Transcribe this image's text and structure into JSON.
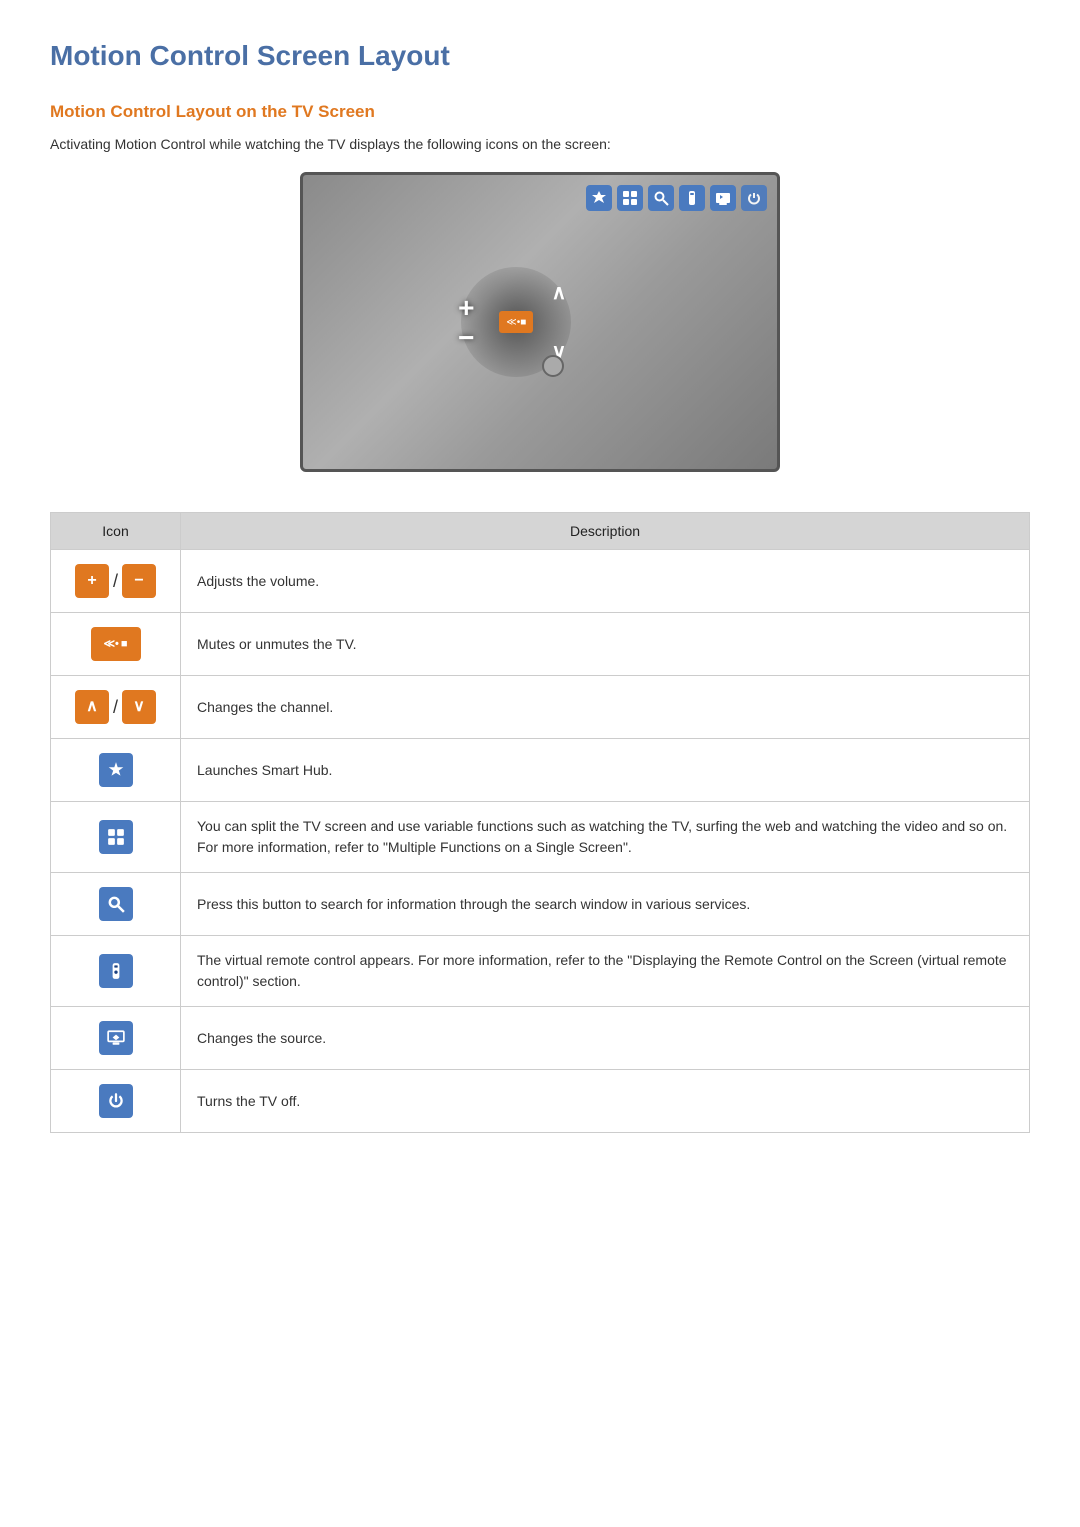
{
  "page": {
    "title": "Motion Control Screen Layout",
    "section_title": "Motion Control Layout on the TV Screen",
    "intro": "Activating Motion Control while watching the TV displays the following icons on the screen:",
    "table": {
      "col_icon": "Icon",
      "col_desc": "Description",
      "rows": [
        {
          "icon_type": "plus_minus",
          "description": "Adjusts the volume."
        },
        {
          "icon_type": "mute",
          "description": "Mutes or unmutes the TV."
        },
        {
          "icon_type": "ch_updown",
          "description": "Changes the channel."
        },
        {
          "icon_type": "smart_hub",
          "description": "Launches Smart Hub."
        },
        {
          "icon_type": "multi",
          "description": "You can split the TV screen and use variable functions such as watching the TV, surfing the web and watching the video and so on. For more information, refer to \"Multiple Functions on a Single Screen\"."
        },
        {
          "icon_type": "search",
          "description": "Press this button to search for information through the search window in various services."
        },
        {
          "icon_type": "remote",
          "description": "The virtual remote control appears. For more information, refer to the \"Displaying the Remote Control on the Screen (virtual remote control)\" section."
        },
        {
          "icon_type": "source",
          "description": "Changes the source."
        },
        {
          "icon_type": "power",
          "description": "Turns the TV off."
        }
      ]
    }
  }
}
